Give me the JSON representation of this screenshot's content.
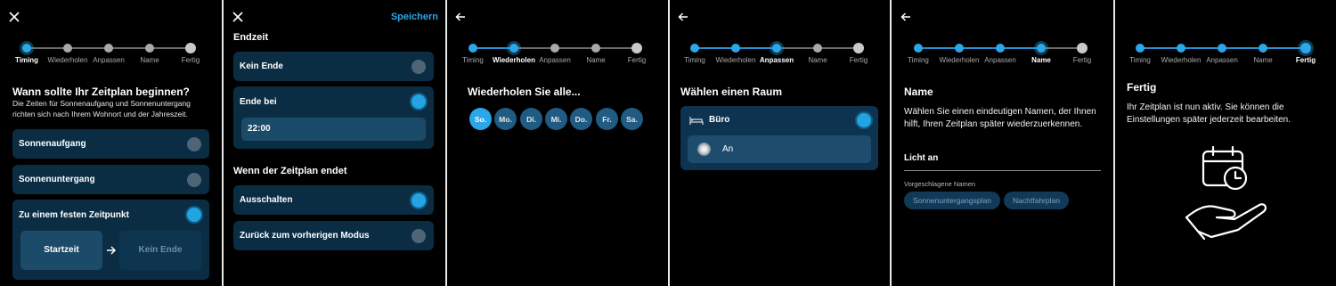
{
  "colors": {
    "accent": "#2ba7e8",
    "card": "#0b2d44",
    "subfield": "#1c4a69",
    "background": "#000000"
  },
  "stepper_labels": [
    "Timing",
    "Wiederholen",
    "Anpassen",
    "Name",
    "Fertig"
  ],
  "screen1": {
    "close_icon": "close-icon",
    "title": "Wann sollte Ihr Zeitplan beginnen?",
    "desc_line1": "Die Zeiten für Sonnenaufgang und Sonnenuntergang",
    "desc_line2": "richten sich nach Ihrem Wohnort und der Jahreszeit.",
    "option_sunrise": "Sonnenaufgang",
    "option_sunset": "Sonnenuntergang",
    "option_fixed": "Zu einem festen Zeitpunkt",
    "start_button": "Startzeit",
    "end_button": "Kein Ende",
    "selected_option": "Zu einem festen Zeitpunkt"
  },
  "screen2": {
    "close_icon": "close-icon",
    "save_label": "Speichern",
    "end_heading": "Endzeit",
    "option_no_end": "Kein Ende",
    "option_end_at": "Ende bei",
    "end_time_value": "22:00",
    "when_heading": "Wenn der Zeitplan endet",
    "option_turn_off": "Ausschalten",
    "option_previous_mode": "Zurück zum vorherigen Modus"
  },
  "screen3": {
    "back_icon": "arrow-left-icon",
    "title": "Wiederholen Sie alle...",
    "days": [
      "So.",
      "Mo.",
      "Di.",
      "Mi.",
      "Do.",
      "Fr.",
      "Sa."
    ],
    "selected_day": "So."
  },
  "screen4": {
    "back_icon": "arrow-left-icon",
    "title": "Wählen einen Raum",
    "room_name": "Büro",
    "room_icon": "bed-icon",
    "state_label": "An"
  },
  "screen5": {
    "back_icon": "arrow-left-icon",
    "title": "Name",
    "desc_line1": "Wählen Sie einen eindeutigen Namen, der Ihnen",
    "desc_line2": "hilft, Ihren Zeitplan später wiederzuerkennen.",
    "name_value": "Licht an",
    "suggestions_label": "Vorgeschlagene Namen",
    "suggestions": [
      "Sonnenuntergangsplan",
      "Nachtfahrplan"
    ]
  },
  "screen6": {
    "title": "Fertig",
    "desc_line1": "Ihr Zeitplan ist nun aktiv. Sie können die",
    "desc_line2": "Einstellungen später jederzeit bearbeiten.",
    "illustration_icon": "calendar-clock-hand-icon"
  }
}
